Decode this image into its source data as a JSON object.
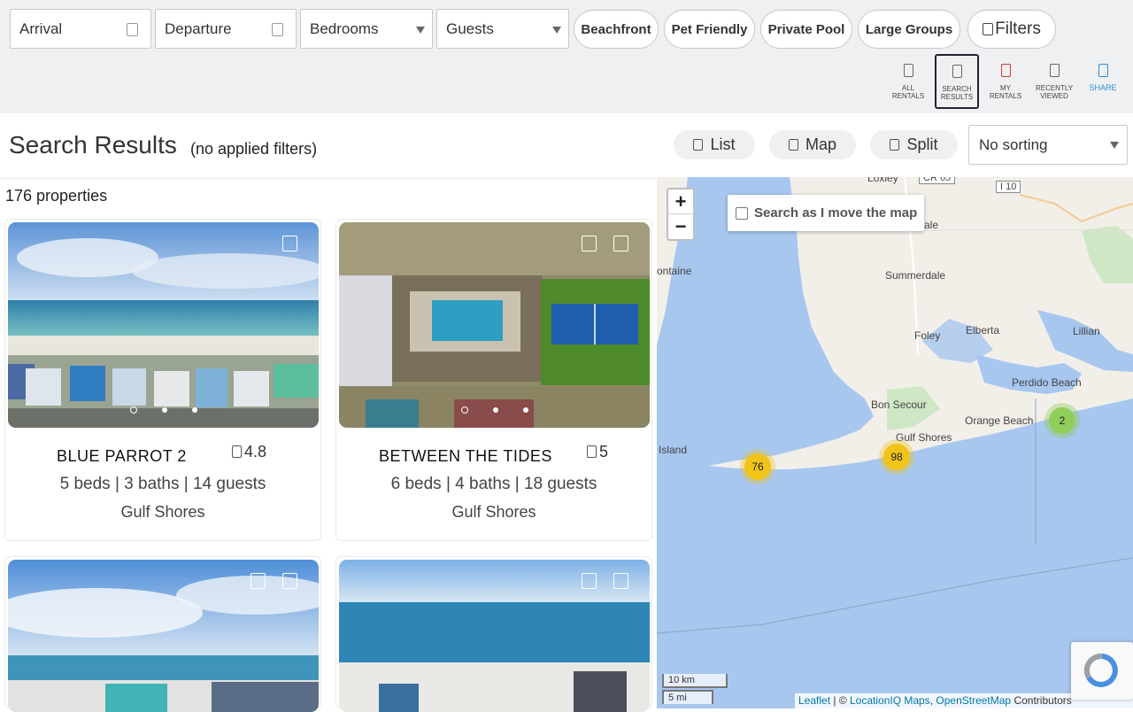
{
  "filters": {
    "arrival": "Arrival",
    "departure": "Departure",
    "bedrooms": "Bedrooms",
    "guests": "Guests",
    "chips": [
      "Beachfront",
      "Pet Friendly",
      "Private Pool",
      "Large Groups"
    ],
    "filters_label": "Filters"
  },
  "view_tabs": [
    {
      "line1": "ALL",
      "line2": "RENTALS"
    },
    {
      "line1": "SEARCH",
      "line2": "RESULTS"
    },
    {
      "line1": "MY",
      "line2": "RENTALS"
    },
    {
      "line1": "RECENTLY",
      "line2": "VIEWED"
    },
    {
      "line1": "SHARE",
      "line2": ""
    }
  ],
  "header": {
    "title": "Search Results",
    "subtitle": "(no applied filters)",
    "view_buttons": [
      "List",
      "Map",
      "Split"
    ],
    "sort_value": "No sorting"
  },
  "results": {
    "count": "176 properties",
    "cards": [
      {
        "name": "BLUE PARROT 2",
        "rating": "4.8",
        "meta": "5 beds | 3 baths | 14 guests",
        "town": "Gulf Shores"
      },
      {
        "name": "BETWEEN THE TIDES",
        "rating": "5",
        "meta": "6 beds | 4 baths | 18 guests",
        "town": "Gulf Shores"
      }
    ]
  },
  "map": {
    "zoom_in": "+",
    "zoom_out": "−",
    "search_as_move": "Search as I move the map",
    "labels": [
      "Loxley",
      "CR 65",
      "I 10",
      "ale",
      "ontaine",
      "Summerdale",
      "Foley",
      "Elberta",
      "Lillian",
      "Perdido Beach",
      "Bon Secour",
      "Orange Beach",
      "Gulf Shores",
      "Island"
    ],
    "clusters": [
      "76",
      "98",
      "2"
    ],
    "scale_km": "10 km",
    "scale_mi": "5 mi",
    "attribution": {
      "leaflet": "Leaflet",
      "sep": " | © ",
      "locationiq": "LocationIQ Maps",
      "comma": ", ",
      "osm": "OpenStreetMap",
      "contrib": " Contributors"
    }
  },
  "colors": {
    "cluster_yellow": "#f0c419",
    "cluster_green": "#8fce5a",
    "water": "#a7c7ef",
    "land": "#f2efe9"
  }
}
